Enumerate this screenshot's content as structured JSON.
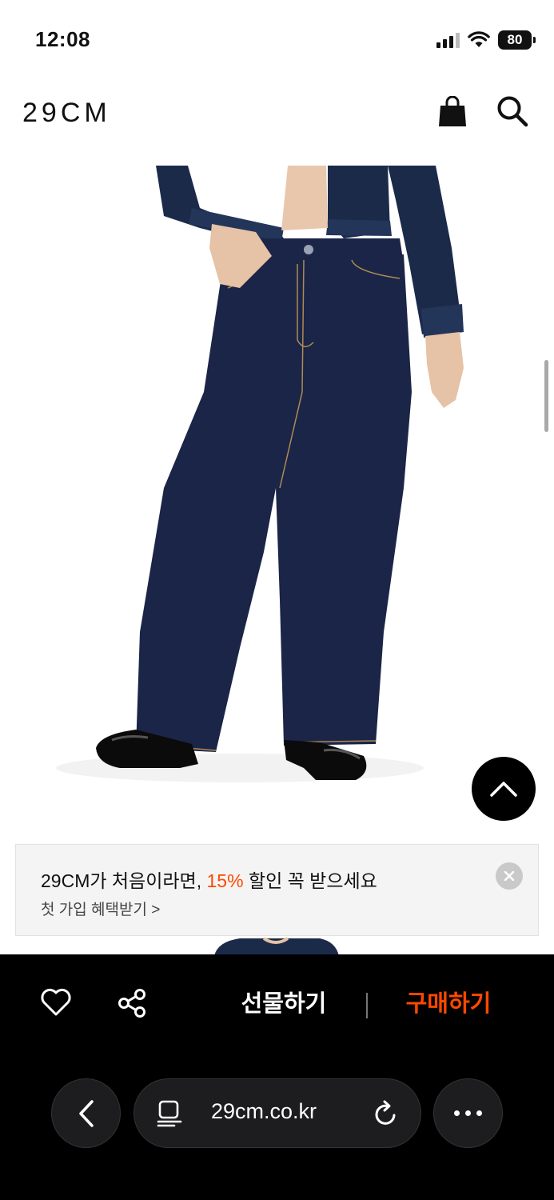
{
  "status_bar": {
    "time": "12:08",
    "battery": "80"
  },
  "header": {
    "logo": "29CM",
    "icons": [
      "shopping-bag-icon",
      "search-icon"
    ]
  },
  "product_image": {
    "description_icon": "product-photo"
  },
  "promo": {
    "title_prefix": "29CM가 처음이라면, ",
    "title_highlight": "15%",
    "title_suffix": " 할인 꼭 받으세요",
    "subtitle": "첫 가입 혜택받기 >",
    "highlight_color": "#ff4800"
  },
  "action_bar": {
    "gift_label": "선물하기",
    "buy_label": "구매하기",
    "buy_color": "#ff4800",
    "icons": [
      "heart-icon",
      "share-icon"
    ]
  },
  "browser": {
    "url": "29cm.co.kr",
    "icons": [
      "back-icon",
      "reader-icon",
      "reload-icon",
      "more-icon"
    ]
  }
}
